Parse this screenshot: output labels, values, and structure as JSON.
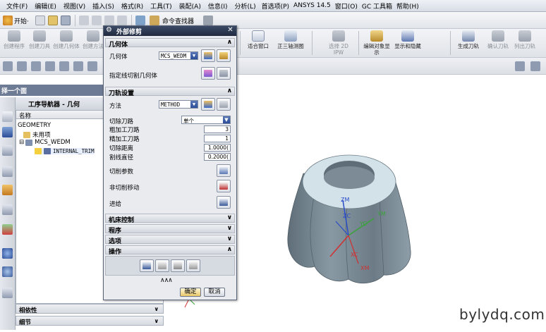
{
  "menubar": {
    "items": [
      "文件(F)",
      "编辑(E)",
      "视图(V)",
      "插入(S)",
      "格式(R)",
      "工具(T)",
      "装配(A)",
      "信息(I)",
      "分析(L)",
      "首选项(P)",
      "ANSYS 14.5",
      "窗口(O)",
      "GC 工具箱",
      "帮助(H)"
    ]
  },
  "toolbar1": {
    "start_label": "开始·",
    "cmd_finder_label": "命令查找器"
  },
  "toolbar2": {
    "buttons": [
      "创建程序",
      "创建刀具",
      "创建几何体",
      "创建方法",
      "适合窗口",
      "正三轴测图",
      "选择 2D IPW",
      "编辑对象显示",
      "显示和隐藏",
      "生成刀轨",
      "确认刀轨",
      "列出刀轨"
    ]
  },
  "selection_bar": {
    "label": "择一个面"
  },
  "navigator": {
    "title": "工序导航器 - 几何",
    "column_header": "名称",
    "tree": {
      "root": "GEOMETRY",
      "unused": "未用项",
      "mcs": "MCS_WEDM",
      "op": "INTERNAL_TRIM"
    },
    "bottom_rows": [
      "相依性",
      "细节"
    ]
  },
  "dialog": {
    "title": "外部修剪",
    "geometry_section": "几何体",
    "geometry_label": "几何体",
    "geometry_value": "MCS_WEDM",
    "specify_trim_geom": "指定线切割几何体",
    "toolpath_section": "刀轨设置",
    "method_label": "方法",
    "method_value": "METHOD",
    "cut_path_label": "切除刀路",
    "cut_path_value": "单个",
    "rough_label": "粗加工刀路",
    "rough_value": "3",
    "finish_label": "精加工刀路",
    "finish_value": "1",
    "cut_dist_label": "切除距离",
    "cut_dist_value": "1.0000(",
    "wire_dia_label": "割线直径",
    "wire_dia_value": "0.2000(",
    "cut_params_label": "切削参数",
    "noncut_label": "非切削移动",
    "feed_label": "进给",
    "sec_machine": "机床控制",
    "sec_program": "程序",
    "sec_options": "选项",
    "sec_operations": "操作",
    "ok_label": "确定",
    "cancel_label": "取消"
  },
  "axes": {
    "zm": "ZM",
    "zc": "ZC",
    "yc": "YC",
    "ym": "YM",
    "xc": "XC",
    "xm": "XM"
  },
  "watermark": "bylydq.com",
  "colors": {
    "dialog_title": "#2a3550",
    "part_side": "#7d8d97",
    "part_top": "#d4e2ea",
    "accent_blue": "#2c4d98"
  }
}
